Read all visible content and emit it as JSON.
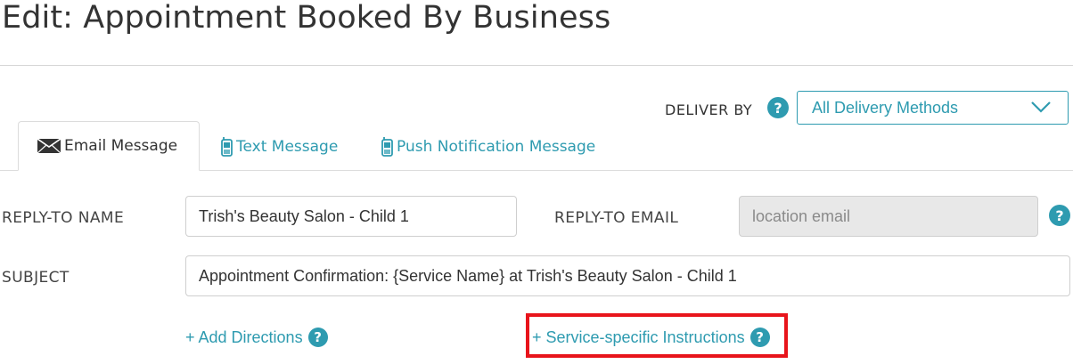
{
  "page": {
    "title": "Edit: Appointment Booked By Business"
  },
  "deliver_by": {
    "label": "DELIVER BY",
    "help_icon": "help-circle-icon",
    "selected": "All Delivery Methods",
    "dropdown_icon": "chevron-down-icon"
  },
  "tabs": [
    {
      "label": "Email Message",
      "icon": "envelope-icon",
      "active": true
    },
    {
      "label": "Text Message",
      "icon": "mobile-phone-icon",
      "active": false
    },
    {
      "label": "Push Notification Message",
      "icon": "mobile-phone-icon",
      "active": false
    }
  ],
  "form": {
    "reply_to_name": {
      "label": "REPLY-TO NAME",
      "value": "Trish's Beauty Salon - Child 1"
    },
    "reply_to_email": {
      "label": "REPLY-TO EMAIL",
      "placeholder": "location email"
    },
    "subject": {
      "label": "SUBJECT",
      "value": "Appointment Confirmation: {Service Name} at Trish's Beauty Salon - Child 1"
    }
  },
  "links": {
    "add_directions": "+ Add Directions",
    "service_instructions": "+ Service-specific Instructions"
  },
  "colors": {
    "accent": "#2e9bb0",
    "highlight": "#e8141b"
  }
}
